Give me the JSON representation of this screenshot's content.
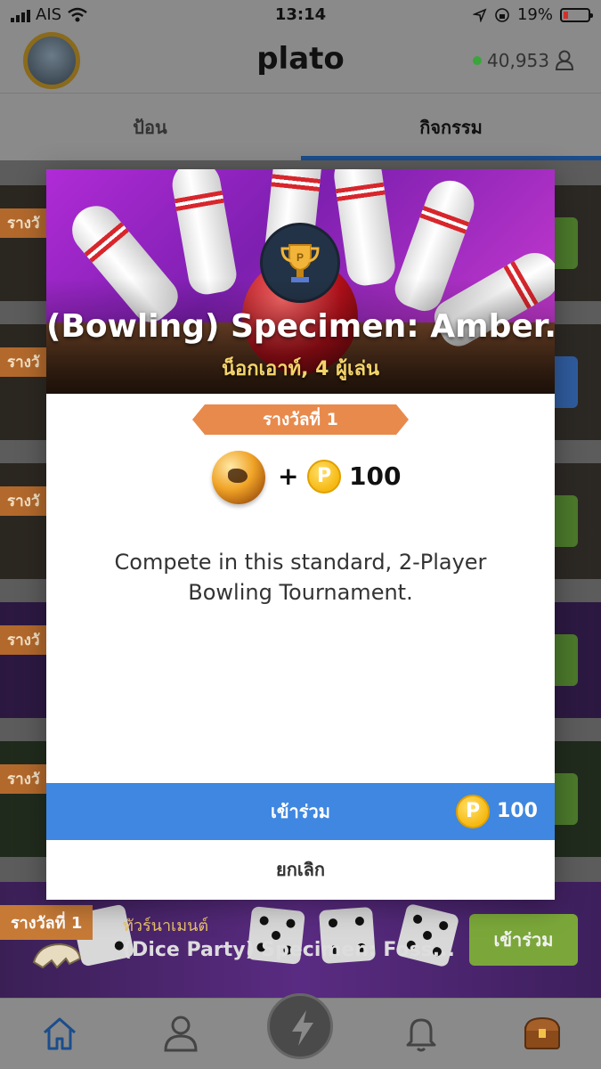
{
  "status_bar": {
    "carrier": "AIS",
    "time": "13:14",
    "battery": "19%"
  },
  "header": {
    "title": "plato",
    "online_count": "40,953"
  },
  "tabs": [
    {
      "label": "ป้อน",
      "active": false
    },
    {
      "label": "กิจกรรม",
      "active": true
    }
  ],
  "background_list": {
    "rank_chip": "รางวั",
    "bottom_item": {
      "rank": "รางวัลที่ 1",
      "kind": "ทัวร์นาเมนต์",
      "name": "(Dice Party) Specimen: Foss...",
      "join_label": "เข้าร่วม"
    }
  },
  "modal": {
    "title": "(Bowling) Specimen: Amber...",
    "subtitle": "น็อกเอาท์, 4 ผู้เล่น",
    "rank_label": "รางวัลที่ 1",
    "reward_plus": "+",
    "reward_coin_symbol": "P",
    "reward_amount": "100",
    "description": "Compete in this standard, 2-Player Bowling Tournament.",
    "join_label": "เข้าร่วม",
    "join_cost": "100",
    "cancel_label": "ยกเลิก"
  },
  "colors": {
    "primary_blue": "#3f87e0",
    "ribbon_orange": "#e88a4c",
    "coin_gold": "#f6b812",
    "join_green": "#7ba73a"
  },
  "bottom_nav": [
    "home-icon",
    "friends-icon",
    "lightning-icon",
    "bell-icon",
    "treasure-chest-icon"
  ]
}
